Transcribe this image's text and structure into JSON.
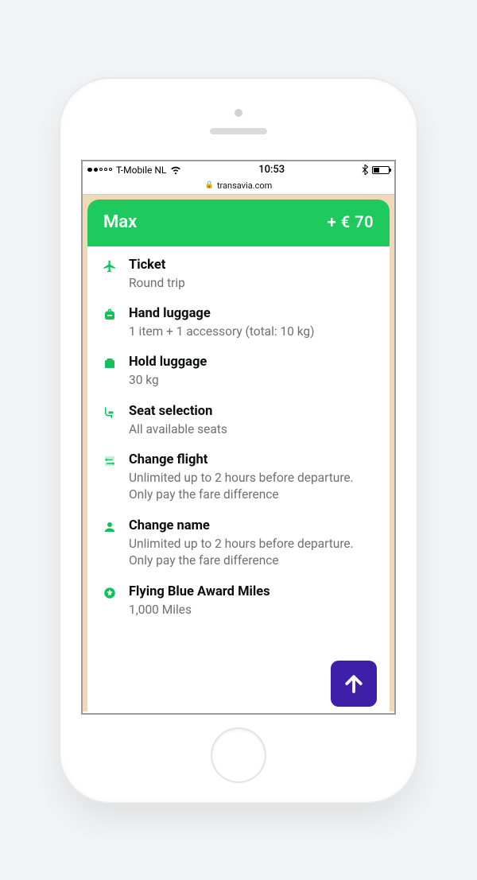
{
  "status": {
    "carrier": "T-Mobile NL",
    "time": "10:53"
  },
  "browser": {
    "domain": "transavia.com"
  },
  "card": {
    "title": "Max",
    "price": "+ € 70"
  },
  "features": [
    {
      "icon": "plane-icon",
      "title": "Ticket",
      "desc": "Round trip"
    },
    {
      "icon": "backpack-icon",
      "title": "Hand luggage",
      "desc": "1 item + 1 accessory (total: 10 kg)"
    },
    {
      "icon": "suitcase-icon",
      "title": "Hold luggage",
      "desc": "30 kg"
    },
    {
      "icon": "seat-icon",
      "title": "Seat selection",
      "desc": "All available seats"
    },
    {
      "icon": "swap-icon",
      "title": "Change flight",
      "desc": "Unlimited up to 2 hours before departure. Only pay the fare difference"
    },
    {
      "icon": "person-icon",
      "title": "Change name",
      "desc": "Unlimited up to 2 hours before departure. Only pay the fare difference"
    },
    {
      "icon": "miles-icon",
      "title": "Flying Blue Award Miles",
      "desc": "1,000 Miles"
    }
  ]
}
